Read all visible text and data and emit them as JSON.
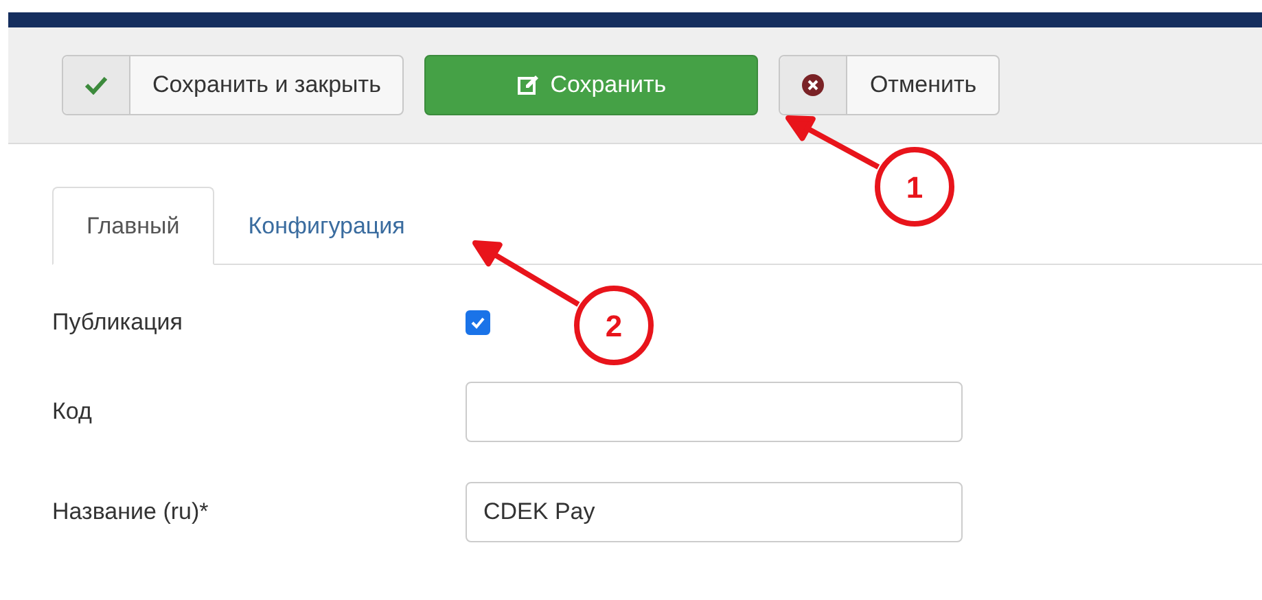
{
  "toolbar": {
    "buttons": [
      {
        "kind": "check",
        "label": "Сохранить и закрыть"
      },
      {
        "kind": "primary",
        "label": "Сохранить"
      },
      {
        "kind": "cancel",
        "label": "Отменить"
      }
    ]
  },
  "tabs": [
    {
      "label": "Главный",
      "selected": true
    },
    {
      "label": "Конфигурация",
      "selected": false
    }
  ],
  "fields": [
    {
      "kind": "checkbox",
      "label": "Публикация",
      "checked": true
    },
    {
      "kind": "text",
      "label": "Код"
    },
    {
      "kind": "text",
      "label": "Название (ru)*",
      "value": "CDEK Pay"
    }
  ],
  "annotations": [
    {
      "number": "1"
    },
    {
      "number": "2"
    }
  ]
}
